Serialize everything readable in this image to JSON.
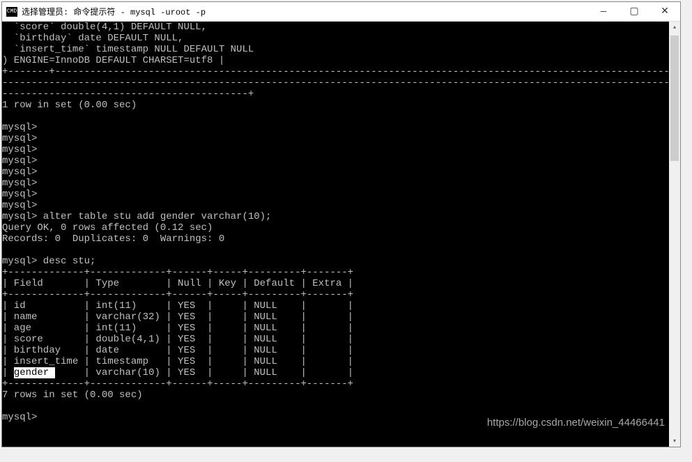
{
  "window": {
    "icon_text": "CMD",
    "title": "选择管理员: 命令提示符 - mysql  -uroot -p",
    "min": "—",
    "max": "▢",
    "close": "✕"
  },
  "scroll": {
    "up": "▴",
    "down": "▾"
  },
  "term": {
    "schema_lines": [
      "  `score` double(4,1) DEFAULT NULL,",
      "  `birthday` date DEFAULT NULL,",
      "  `insert_time` timestamp NULL DEFAULT NULL",
      ") ENGINE=InnoDB DEFAULT CHARSET=utf8 |"
    ],
    "divider1": "+-------+---------------------------------------------------------------------------------------------------------------------------",
    "divider1b": "-----------------------------------------------------------------------------------------------------------------------------------",
    "divider1c": "------------------------------------------+",
    "rows_msg1": "1 row in set (0.00 sec)",
    "prompts": [
      "mysql>",
      "mysql>",
      "mysql>",
      "mysql>",
      "mysql>",
      "mysql>",
      "mysql>",
      "mysql>"
    ],
    "alter_cmd": "mysql> alter table stu add gender varchar(10);",
    "query_ok": "Query OK, 0 rows affected (0.12 sec)",
    "records": "Records: 0  Duplicates: 0  Warnings: 0",
    "desc_cmd": "mysql> desc stu;",
    "tbl_border": "+-------------+-------------+------+-----+---------+-------+",
    "tbl_header": "| Field       | Type        | Null | Key | Default | Extra |",
    "tbl_rows": [
      "| id          | int(11)     | YES  |     | NULL    |       |",
      "| name        | varchar(32) | YES  |     | NULL    |       |",
      "| age         | int(11)     | YES  |     | NULL    |       |",
      "| score       | double(4,1) | YES  |     | NULL    |       |",
      "| birthday    | date        | YES  |     | NULL    |       |",
      "| insert_time | timestamp   | YES  |     | NULL    |       |"
    ],
    "tbl_row_hl_pre": "| ",
    "tbl_row_hl": "gender ",
    "tbl_row_hl_post": "     | varchar(10) | YES  |     | NULL    |       |",
    "rows_msg2": "7 rows in set (0.00 sec)",
    "final_prompt": "mysql>"
  },
  "watermark": "https://blog.csdn.net/weixin_44466441"
}
